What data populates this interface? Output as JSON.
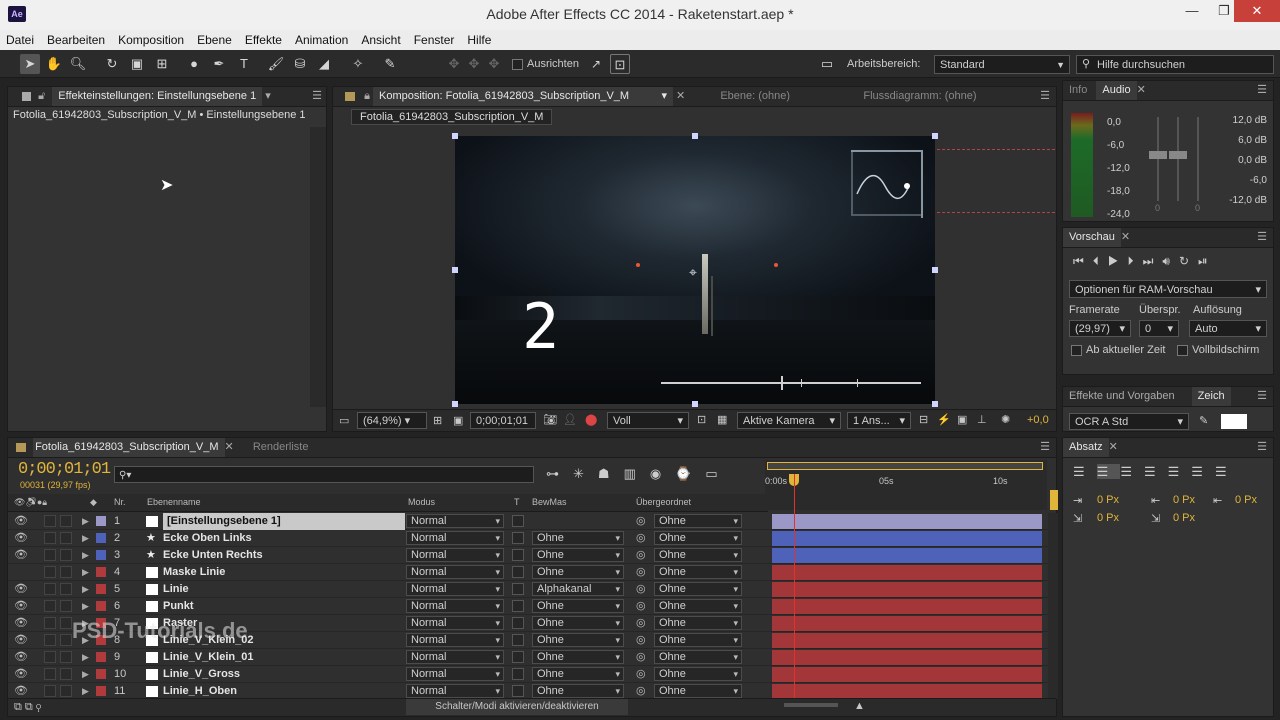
{
  "window": {
    "app_icon": "Ae",
    "title": "Adobe After Effects CC 2014 - Raketenstart.aep *"
  },
  "menu": [
    "Datei",
    "Bearbeiten",
    "Komposition",
    "Ebene",
    "Effekte",
    "Animation",
    "Ansicht",
    "Fenster",
    "Hilfe"
  ],
  "toolbar": {
    "align_label": "Ausrichten",
    "workspace_label": "Arbeitsbereich:",
    "workspace_value": "Standard",
    "help_placeholder": "Hilfe durchsuchen"
  },
  "effects_panel": {
    "tab": "Effekteinstellungen: Einstellungsebene 1",
    "layer_path": "Fotolia_61942803_Subscription_V_M • Einstellungsebene 1"
  },
  "comp_panel": {
    "tab": "Komposition: Fotolia_61942803_Subscription_V_M",
    "tab_layer": "Ebene: (ohne)",
    "tab_flow": "Flussdiagramm: (ohne)",
    "comp_name": "Fotolia_61942803_Subscription_V_M",
    "countdown_digit": "2",
    "zoom": "(64,9%)",
    "timecode": "0;00;01;01",
    "resolution": "Voll",
    "camera": "Aktive Kamera",
    "view": "1 Ans...",
    "exposure": "+0,0"
  },
  "info_panel": {
    "tab_info": "Info",
    "tab_audio": "Audio",
    "left_scale": [
      "0,0",
      "-6,0",
      "-12,0",
      "-18,0",
      "-24,0"
    ],
    "right_scale": [
      "12,0 dB",
      "6,0 dB",
      "0,0 dB",
      "-6,0",
      "-12,0 dB"
    ],
    "slider_values": [
      "0",
      "0"
    ]
  },
  "preview_panel": {
    "tab": "Vorschau",
    "options": "Optionen für RAM-Vorschau",
    "framerate_label": "Framerate",
    "skip_label": "Überspr.",
    "resolution_label": "Auflösung",
    "framerate": "(29,97)",
    "skip": "0",
    "resolution": "Auto",
    "from_current": "Ab aktueller Zeit",
    "fullscreen": "Vollbildschirm"
  },
  "effects_presets": {
    "tab": "Effekte und Vorgaben",
    "tab2": "Zeich",
    "font": "OCR A Std"
  },
  "paragraph_panel": {
    "tab": "Absatz",
    "values": [
      "0 Px",
      "0 Px",
      "0 Px",
      "0 Px",
      "0 Px"
    ]
  },
  "timeline": {
    "tab": "Fotolia_61942803_Subscription_V_M",
    "tab_render": "Renderliste",
    "timecode": "0;00;01;01",
    "frames": "00031 (29,97 fps)",
    "search_placeholder": "",
    "headers": {
      "nr": "Nr.",
      "name": "Ebenenname",
      "mode": "Modus",
      "t": "T",
      "trkmat": "BewMas",
      "parent": "Übergeordnet"
    },
    "ruler": [
      "0:00s",
      "05s",
      "10s"
    ],
    "bottom_label": "Schalter/Modi aktivieren/deaktivieren",
    "colors": {
      "lavender": "#9b97c6",
      "blue": "#4d62b8",
      "red": "#b13b3c",
      "playhead": "#e0342a",
      "accent": "#e0b53a"
    },
    "layers": [
      {
        "nr": "1",
        "name": "[Einstellungsebene 1]",
        "mode": "Normal",
        "trkmat": "",
        "parent": "Ohne",
        "color": "#9b97c6",
        "barcolor": "#9b97c6"
      },
      {
        "nr": "2",
        "name": "Ecke Oben Links",
        "mode": "Normal",
        "trkmat": "Ohne",
        "parent": "Ohne",
        "color": "#4d62b8",
        "barcolor": "#4d62b8"
      },
      {
        "nr": "3",
        "name": "Ecke Unten Rechts",
        "mode": "Normal",
        "trkmat": "Ohne",
        "parent": "Ohne",
        "color": "#4d62b8",
        "barcolor": "#4d62b8"
      },
      {
        "nr": "4",
        "name": "Maske Linie",
        "mode": "Normal",
        "trkmat": "Ohne",
        "parent": "Ohne",
        "color": "#b13b3c",
        "barcolor": "#a23638"
      },
      {
        "nr": "5",
        "name": "Linie",
        "mode": "Normal",
        "trkmat": "Alphakanal",
        "parent": "Ohne",
        "color": "#b13b3c",
        "barcolor": "#a23638"
      },
      {
        "nr": "6",
        "name": "Punkt",
        "mode": "Normal",
        "trkmat": "Ohne",
        "parent": "Ohne",
        "color": "#b13b3c",
        "barcolor": "#a23638"
      },
      {
        "nr": "7",
        "name": "Raster",
        "mode": "Normal",
        "trkmat": "Ohne",
        "parent": "Ohne",
        "color": "#b13b3c",
        "barcolor": "#a23638"
      },
      {
        "nr": "8",
        "name": "Linie_V_Klein_02",
        "mode": "Normal",
        "trkmat": "Ohne",
        "parent": "Ohne",
        "color": "#b13b3c",
        "barcolor": "#a23638"
      },
      {
        "nr": "9",
        "name": "Linie_V_Klein_01",
        "mode": "Normal",
        "trkmat": "Ohne",
        "parent": "Ohne",
        "color": "#b13b3c",
        "barcolor": "#a23638"
      },
      {
        "nr": "10",
        "name": "Linie_V_Gross",
        "mode": "Normal",
        "trkmat": "Ohne",
        "parent": "Ohne",
        "color": "#b13b3c",
        "barcolor": "#a23638"
      },
      {
        "nr": "11",
        "name": "Linie_H_Oben",
        "mode": "Normal",
        "trkmat": "Ohne",
        "parent": "Ohne",
        "color": "#b13b3c",
        "barcolor": "#a23638"
      }
    ]
  },
  "watermark": "PSD-Tutorials.de"
}
